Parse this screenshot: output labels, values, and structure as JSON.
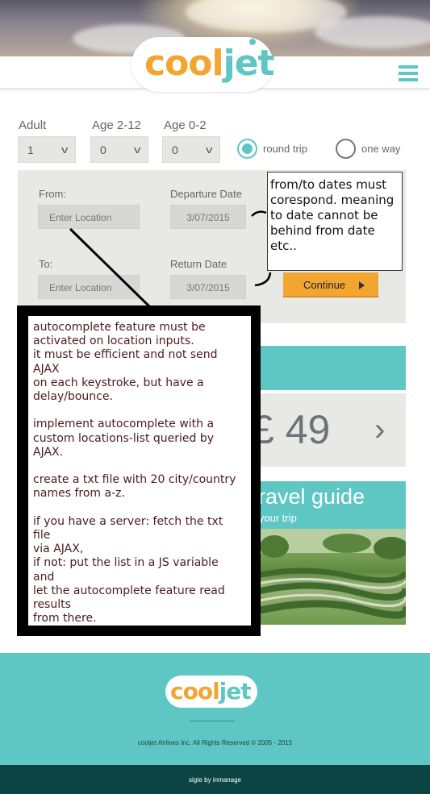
{
  "brand": {
    "logo_part1": "cool",
    "logo_part2": "jet",
    "primary_color": "#5ec7c4",
    "accent_color": "#f2a531"
  },
  "header": {
    "menu_icon": "hamburger-menu-icon"
  },
  "passengers": {
    "adult": {
      "label": "Adult",
      "value": "1"
    },
    "child": {
      "label": "Age 2-12",
      "value": "0"
    },
    "infant": {
      "label": "Age 0-2",
      "value": "0"
    }
  },
  "trip_type": {
    "round_trip": {
      "label": "round trip",
      "selected": true
    },
    "one_way": {
      "label": "one way",
      "selected": false
    }
  },
  "search": {
    "from_label": "From:",
    "from_placeholder": "Enter Location",
    "to_label": "To:",
    "to_placeholder": "Enter Location",
    "departure_label": "Departure Date",
    "departure_value": "3/07/2015",
    "return_label": "Return Date",
    "return_value": "3/07/2015",
    "continue_label": "Continue"
  },
  "deals": {
    "price": "£ 49",
    "next_arrow": "›",
    "guide_title": "ravel guide",
    "guide_subtitle": "d your trip"
  },
  "notes": {
    "dates_note": "from/to dates must\ncorespond. meaning\nto date cannot be\nbehind from date\netc..",
    "autocomplete_note": "autocomplete feature must be\nactivated on location inputs.\nit must be efficient and not send\nAJAX\non each keystroke, but have a\ndelay/bounce.\n\nimplement autocomplete with a\ncustom locations-list queried by\nAJAX.\n\ncreate a txt file with 20 city/country\nnames from a-z.\n\nif you have a server: fetch the txt\nfile\nvia AJAX,\nif not: put the list in a JS variable\nand\nlet the autocomplete feature read\nresults\nfrom there."
  },
  "footer": {
    "logo_part1": "cool",
    "logo_part2": "jet",
    "copyright": "cooljet Airlines Inc. All Rights Reserved © 2005 - 2015",
    "credit": "sigte by inmanage"
  }
}
